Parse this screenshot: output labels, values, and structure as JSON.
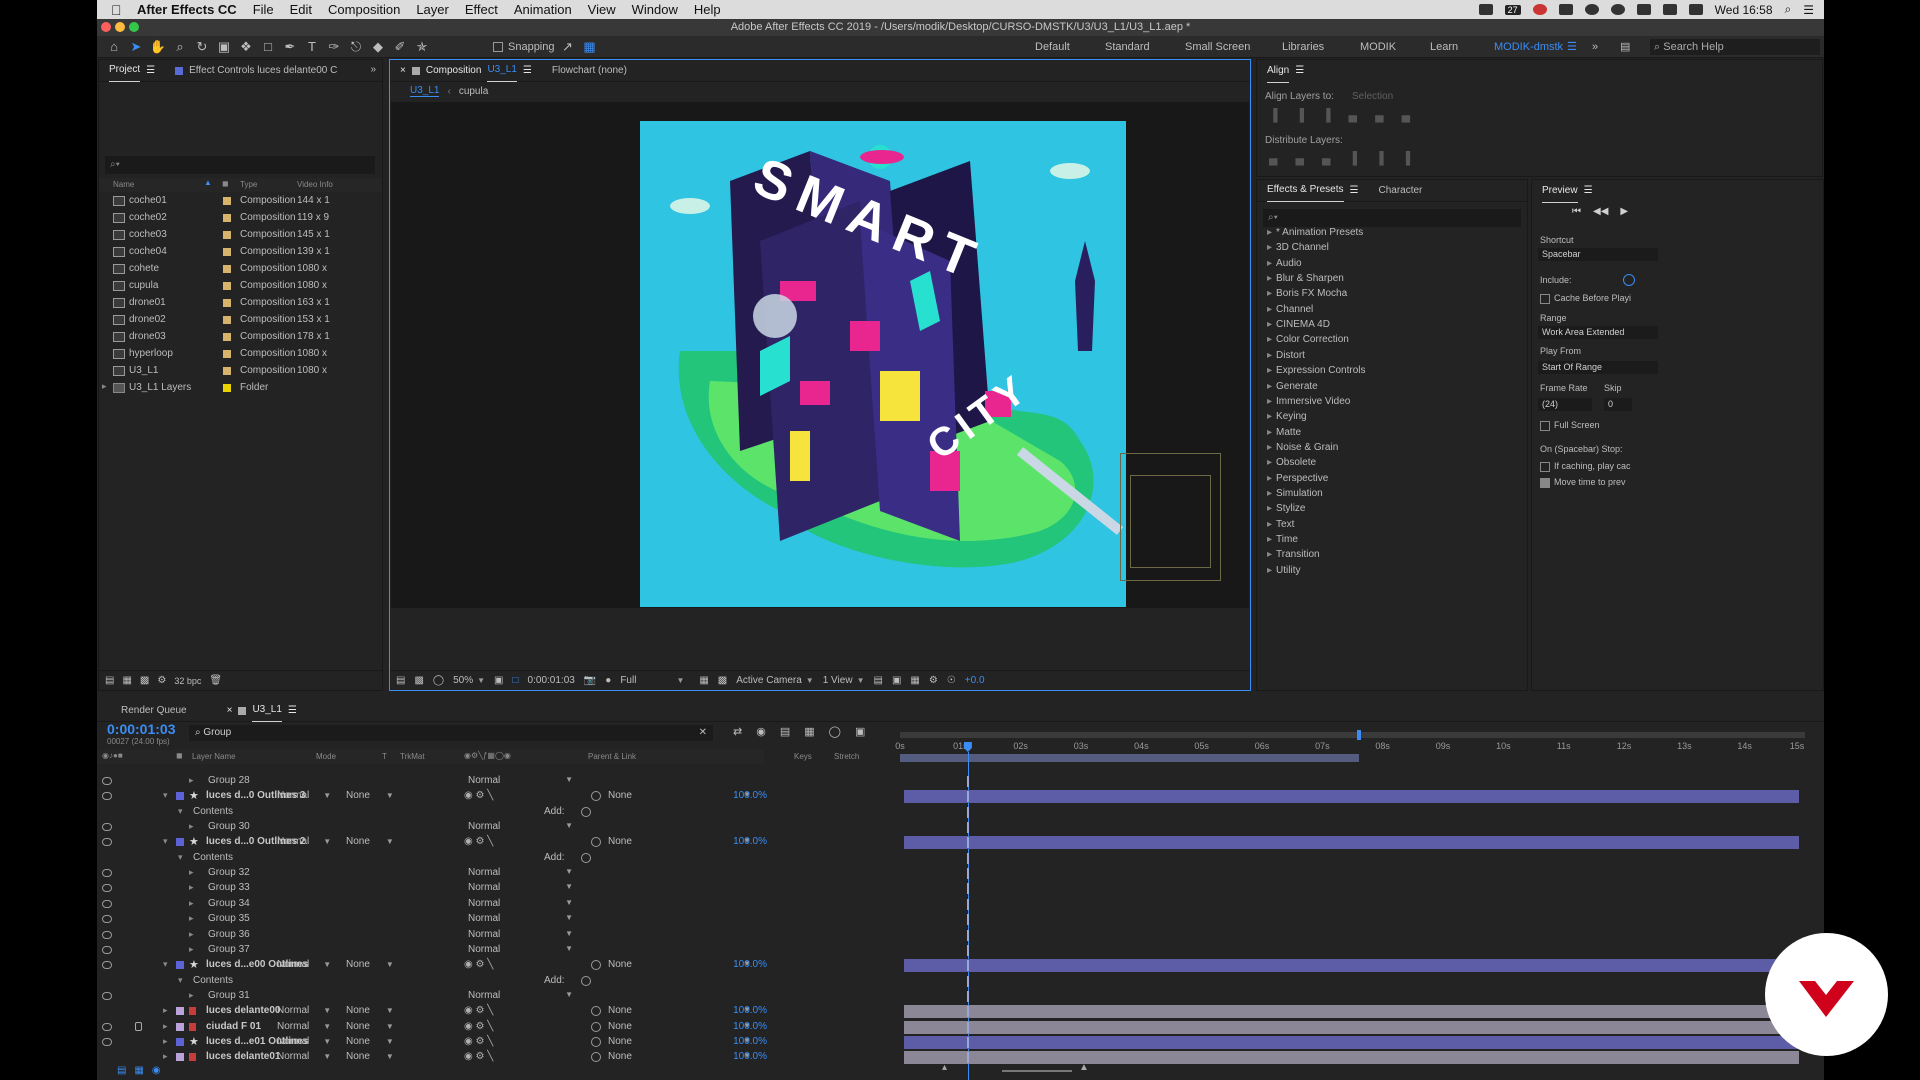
{
  "menubar": {
    "app_name": "After Effects CC",
    "items": [
      "File",
      "Edit",
      "Composition",
      "Layer",
      "Effect",
      "Animation",
      "View",
      "Window",
      "Help"
    ],
    "battery": "27",
    "clock": "Wed 16:58"
  },
  "window_title": "Adobe After Effects CC 2019 - /Users/modik/Desktop/CURSO-DMSTK/U3/U3_L1/U3_L1.aep *",
  "toolbar": {
    "snapping": "Snapping",
    "workspaces": [
      "Default",
      "Standard",
      "Small Screen",
      "Libraries",
      "MODIK",
      "Learn"
    ],
    "active_workspace": "MODIK-dmstk",
    "search_help": "Search Help"
  },
  "project_panel": {
    "tab_project": "Project",
    "tab_effect_controls": "Effect Controls luces delante00 C",
    "columns": {
      "name": "Name",
      "type": "Type",
      "video_info": "Video Info"
    },
    "items": [
      {
        "name": "coche01",
        "type": "Composition",
        "video_info": "144 x 1"
      },
      {
        "name": "coche02",
        "type": "Composition",
        "video_info": "119 x 9"
      },
      {
        "name": "coche03",
        "type": "Composition",
        "video_info": "145 x 1"
      },
      {
        "name": "coche04",
        "type": "Composition",
        "video_info": "139 x 1"
      },
      {
        "name": "cohete",
        "type": "Composition",
        "video_info": "1080 x"
      },
      {
        "name": "cupula",
        "type": "Composition",
        "video_info": "1080 x"
      },
      {
        "name": "drone01",
        "type": "Composition",
        "video_info": "163 x 1"
      },
      {
        "name": "drone02",
        "type": "Composition",
        "video_info": "153 x 1"
      },
      {
        "name": "drone03",
        "type": "Composition",
        "video_info": "178 x 1"
      },
      {
        "name": "hyperloop",
        "type": "Composition",
        "video_info": "1080 x"
      },
      {
        "name": "U3_L1",
        "type": "Composition",
        "video_info": "1080 x"
      },
      {
        "name": "U3_L1 Layers",
        "type": "Folder",
        "video_info": ""
      }
    ],
    "bpc": "32 bpc"
  },
  "composition_panel": {
    "tab_label": "Composition",
    "tab_comp": "U3_L1",
    "flowchart": "Flowchart (none)",
    "breadcrumb": [
      "U3_L1",
      "cupula"
    ],
    "artwork_text": {
      "line1": "SMART",
      "line2": "CITY"
    },
    "zoom": "50%",
    "timecode": "0:00:01:03",
    "resolution": "Full",
    "camera": "Active Camera",
    "views": "1 View",
    "exposure": "+0.0"
  },
  "align_panel": {
    "title": "Align",
    "align_layers_to": "Align Layers to:",
    "align_to_value": "Selection",
    "distribute_layers": "Distribute Layers:"
  },
  "effects_panel": {
    "tab_effects": "Effects & Presets",
    "tab_character": "Character",
    "categories": [
      "* Animation Presets",
      "3D Channel",
      "Audio",
      "Blur & Sharpen",
      "Boris FX Mocha",
      "Channel",
      "CINEMA 4D",
      "Color Correction",
      "Distort",
      "Expression Controls",
      "Generate",
      "Immersive Video",
      "Keying",
      "Matte",
      "Noise & Grain",
      "Obsolete",
      "Perspective",
      "Simulation",
      "Stylize",
      "Text",
      "Time",
      "Transition",
      "Utility"
    ]
  },
  "preview_panel": {
    "title": "Preview",
    "shortcut_label": "Shortcut",
    "shortcut_value": "Spacebar",
    "include_label": "Include:",
    "cache_before": "Cache Before Playi",
    "range_label": "Range",
    "range_value": "Work Area Extended",
    "play_from_label": "Play From",
    "play_from_value": "Start Of Range",
    "frame_rate_label": "Frame Rate",
    "skip_label": "Skip",
    "frame_rate_value": "(24)",
    "skip_value": "0",
    "full_screen": "Full Screen",
    "on_stop": "On (Spacebar) Stop:",
    "if_caching": "If caching, play cac",
    "move_time": "Move time to prev"
  },
  "timeline": {
    "tab_render_queue": "Render Queue",
    "tab_comp": "U3_L1",
    "timecode": "0:00:01:03",
    "frame_info": "00027 (24.00 fps)",
    "search_value": "Group",
    "columns": {
      "layer_name": "Layer Name",
      "mode": "Mode",
      "t": "T",
      "trkmat": "TrkMat",
      "parent": "Parent & Link",
      "keys": "Keys",
      "stretch": "Stretch"
    },
    "ruler": [
      "0s",
      "01s",
      "02s",
      "03s",
      "04s",
      "05s",
      "06s",
      "07s",
      "08s",
      "09s",
      "10s",
      "11s",
      "12s",
      "13s",
      "14s",
      "15s"
    ],
    "playhead_sec": 1.125,
    "work_area_end_sec": 7.6,
    "duration_sec": 15,
    "rows": [
      {
        "kind": "group",
        "name": "Group 28",
        "blend": "Normal",
        "eye": true
      },
      {
        "kind": "layer",
        "name": "luces d...0 Outlines 3",
        "mode": "Normal",
        "trkmat": "None",
        "parent": "None",
        "stretch": "100.0%",
        "eye": true,
        "open": true
      },
      {
        "kind": "contents",
        "name": "Contents",
        "add": "Add:"
      },
      {
        "kind": "group",
        "name": "Group 30",
        "blend": "Normal",
        "eye": true
      },
      {
        "kind": "layer",
        "name": "luces d...0 Outlines 2",
        "mode": "Normal",
        "trkmat": "None",
        "parent": "None",
        "stretch": "100.0%",
        "eye": true,
        "open": true
      },
      {
        "kind": "contents",
        "name": "Contents",
        "add": "Add:"
      },
      {
        "kind": "group",
        "name": "Group 32",
        "blend": "Normal",
        "eye": true
      },
      {
        "kind": "group",
        "name": "Group 33",
        "blend": "Normal",
        "eye": true
      },
      {
        "kind": "group",
        "name": "Group 34",
        "blend": "Normal",
        "eye": true
      },
      {
        "kind": "group",
        "name": "Group 35",
        "blend": "Normal",
        "eye": true
      },
      {
        "kind": "group",
        "name": "Group 36",
        "blend": "Normal",
        "eye": true
      },
      {
        "kind": "group",
        "name": "Group 37",
        "blend": "Normal",
        "eye": true
      },
      {
        "kind": "layer",
        "name": "luces d...e00 Outlines",
        "mode": "Normal",
        "trkmat": "None",
        "parent": "None",
        "stretch": "100.0%",
        "eye": true,
        "open": true
      },
      {
        "kind": "contents",
        "name": "Contents",
        "add": "Add:"
      },
      {
        "kind": "group",
        "name": "Group 31",
        "blend": "Normal",
        "eye": true
      },
      {
        "kind": "layer",
        "name": "luces delante00",
        "mode": "Normal",
        "trkmat": "None",
        "parent": "None",
        "stretch": "100.0%",
        "eye": false,
        "open": false,
        "icon": "comp"
      },
      {
        "kind": "layer",
        "name": "ciudad F 01",
        "mode": "Normal",
        "trkmat": "None",
        "parent": "None",
        "stretch": "100.0%",
        "eye": true,
        "open": false,
        "icon": "comp",
        "locked": true
      },
      {
        "kind": "layer",
        "name": "luces d...e01 Outlines",
        "mode": "Normal",
        "trkmat": "None",
        "parent": "None",
        "stretch": "100.0%",
        "eye": true,
        "open": false
      },
      {
        "kind": "layer",
        "name": "luces delante01",
        "mode": "Normal",
        "trkmat": "None",
        "parent": "None",
        "stretch": "100.0%",
        "eye": false,
        "open": false,
        "icon": "comp"
      }
    ]
  },
  "colors": {
    "accent": "#3a8df5",
    "panel": "#232323",
    "layer_bar": "#5d5ca6",
    "work_area": "#3a8df5",
    "logo": "#d0021b"
  }
}
